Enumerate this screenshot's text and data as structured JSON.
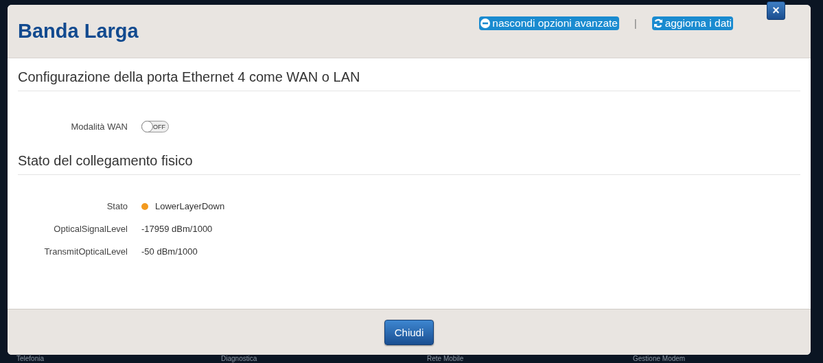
{
  "dialog": {
    "title": "Banda Larga",
    "links": [
      {
        "kind": "hide",
        "label": "nascondi opzioni avanzate"
      },
      {
        "kind": "refresh",
        "label": "aggiorna i dati"
      }
    ],
    "separator": "|",
    "close_button": "×"
  },
  "sections": [
    {
      "title": "Configurazione della porta Ethernet 4 come WAN o LAN",
      "fields": [
        {
          "kind": "toggle",
          "label": "Modalità WAN",
          "on": false,
          "state_text": "OFF"
        }
      ]
    },
    {
      "title": "Stato del collegamento fisico",
      "fields": [
        {
          "kind": "status",
          "label": "Stato",
          "value": "LowerLayerDown",
          "color": "#f39a1e"
        },
        {
          "kind": "text",
          "label": "OpticalSignalLevel",
          "value": "-17959 dBm/1000"
        },
        {
          "kind": "text",
          "label": "TransmitOpticalLevel",
          "value": "-50 dBm/1000"
        }
      ]
    }
  ],
  "footer": {
    "button": "Chiudi"
  },
  "background_menu": [
    "Telefonia",
    "Diagnostica",
    "Rete Mobile",
    "Gestione Modem"
  ]
}
